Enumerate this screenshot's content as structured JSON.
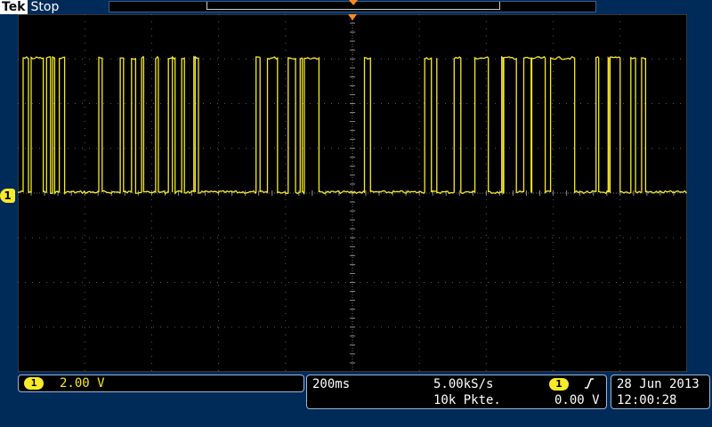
{
  "header": {
    "brand": "Tek",
    "status": "Stop"
  },
  "channel": {
    "number": "1",
    "scale": "2.00 V",
    "color": "#f7ea2b"
  },
  "timebase": {
    "scale": "200ms",
    "sample_rate": "5.00kS/s",
    "record_length": "10k Pkte."
  },
  "trigger": {
    "source": "1",
    "level": "0.00 V",
    "slope_icon": "rising-edge-icon"
  },
  "clock": {
    "date": "28 Jun 2013",
    "time": "12:00:28"
  },
  "colors": {
    "background": "#002b59",
    "screen": "#000000",
    "trace": "#f7ea2b",
    "trigger_marker": "#ff8c1a"
  },
  "waveform": {
    "low_level_div": 0.0,
    "high_level_div": 3.0,
    "transitions_div": [
      0.08,
      0.16,
      0.2,
      0.38,
      0.43,
      0.49,
      0.52,
      0.55,
      0.62,
      0.7,
      1.21,
      1.26,
      1.53,
      1.58,
      1.7,
      1.76,
      1.85,
      1.88,
      2.06,
      2.1,
      2.25,
      2.31,
      2.31,
      2.35,
      2.45,
      2.49,
      2.63,
      2.65,
      2.65,
      2.7,
      3.56,
      3.62,
      3.73,
      3.88,
      4.04,
      4.15,
      4.22,
      4.25,
      4.28,
      4.5,
      5.18,
      5.27,
      6.08,
      6.18,
      6.26,
      6.26,
      6.52,
      6.62,
      6.83,
      7.03,
      7.23,
      7.25,
      7.26,
      7.45,
      7.56,
      7.67,
      7.68,
      7.88,
      7.96,
      8.32,
      8.64,
      8.68,
      8.82,
      8.83,
      8.85,
      9.0,
      9.16,
      9.23,
      9.32,
      9.38
    ],
    "start_level": "low",
    "end_level": "high"
  }
}
